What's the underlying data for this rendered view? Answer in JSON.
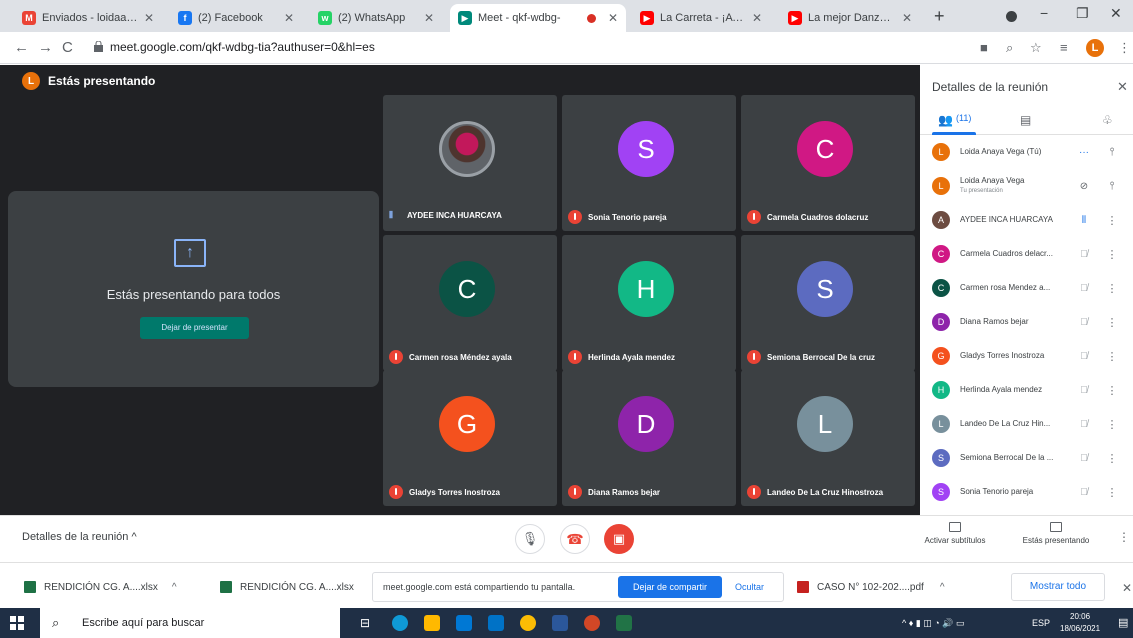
{
  "browser": {
    "tabs": [
      {
        "title": "Enviados - loidaav.2@",
        "favicon": "gmail-icon",
        "favicon_color": "#ea4335",
        "favicon_glyph": "M"
      },
      {
        "title": "(2) Facebook",
        "favicon": "facebook-icon",
        "favicon_color": "#1877f2",
        "favicon_glyph": "f"
      },
      {
        "title": "(2) WhatsApp",
        "favicon": "whatsapp-icon",
        "favicon_color": "#25d366",
        "favicon_glyph": "w"
      },
      {
        "title": "Meet - qkf-wdbg-",
        "favicon": "meet-icon",
        "favicon_color": "#00897b",
        "favicon_glyph": "▶",
        "active": true
      },
      {
        "title": "La Carreta - ¡A quién",
        "favicon": "youtube-icon",
        "favicon_color": "#ff0000",
        "favicon_glyph": "▶"
      },
      {
        "title": "La mejor Danza TINKU",
        "favicon": "youtube-icon",
        "favicon_color": "#ff0000",
        "favicon_glyph": "▶"
      }
    ],
    "new_tab": "+",
    "url": "meet.google.com/qkf-wdbg-tia?authuser=0&hl=es"
  },
  "meet": {
    "presenting_label": "Estás presentando",
    "presenter_initial": "L",
    "present_title": "Estás presentando para todos",
    "stop_presenting": "Dejar de presentar",
    "tiles": [
      {
        "name": "AYDEE INCA HUARCAYA",
        "initial": "",
        "color": "#5f6368",
        "mic": "on",
        "photo": true
      },
      {
        "name": "Sonia Tenorio pareja",
        "initial": "S",
        "color": "#a142f4",
        "mic": "off"
      },
      {
        "name": "Carmela Cuadros dolacruz",
        "initial": "C",
        "color": "#d01884",
        "mic": "off"
      },
      {
        "name": "Carmen rosa Méndez ayala",
        "initial": "C",
        "color": "#0b5345",
        "mic": "off"
      },
      {
        "name": "Herlinda Ayala mendez",
        "initial": "H",
        "color": "#12b886",
        "mic": "off"
      },
      {
        "name": "Semiona Berrocal De la cruz",
        "initial": "S",
        "color": "#5c6bc0",
        "mic": "off"
      },
      {
        "name": "Gladys Torres Inostroza",
        "initial": "G",
        "color": "#f4511e",
        "mic": "off"
      },
      {
        "name": "Diana Ramos bejar",
        "initial": "D",
        "color": "#8e24aa",
        "mic": "off"
      },
      {
        "name": "Landeo De La Cruz Hinostroza",
        "initial": "L",
        "color": "#78909c",
        "mic": "off"
      }
    ],
    "details_link": "Detalles de la reunión  ^",
    "captions_label": "Activar subtítulos",
    "presenting_status": "Estás presentando"
  },
  "panel": {
    "title": "Detalles de la reunión",
    "people_count": "(11)",
    "participants": [
      {
        "name": "Loida Anaya Vega (Tú)",
        "sub": "",
        "initial": "L",
        "color": "#e8710a",
        "mic": "more"
      },
      {
        "name": "Loida Anaya Vega",
        "sub": "Tu presentación",
        "initial": "L",
        "color": "#e8710a",
        "mic": "present"
      },
      {
        "name": "AYDEE INCA HUARCAYA",
        "sub": "",
        "initial": "A",
        "color": "#6d4c41",
        "mic": "on"
      },
      {
        "name": "Carmela Cuadros delacr...",
        "sub": "",
        "initial": "C",
        "color": "#d01884",
        "mic": "off"
      },
      {
        "name": "Carmen rosa Mendez a...",
        "sub": "",
        "initial": "C",
        "color": "#0b5345",
        "mic": "off"
      },
      {
        "name": "Diana Ramos bejar",
        "sub": "",
        "initial": "D",
        "color": "#8e24aa",
        "mic": "off"
      },
      {
        "name": "Gladys Torres Inostroza",
        "sub": "",
        "initial": "G",
        "color": "#f4511e",
        "mic": "off"
      },
      {
        "name": "Herlinda Ayala mendez",
        "sub": "",
        "initial": "H",
        "color": "#12b886",
        "mic": "off"
      },
      {
        "name": "Landeo De La Cruz Hin...",
        "sub": "",
        "initial": "L",
        "color": "#78909c",
        "mic": "off"
      },
      {
        "name": "Semiona Berrocal De la ...",
        "sub": "",
        "initial": "S",
        "color": "#5c6bc0",
        "mic": "off"
      },
      {
        "name": "Sonia Tenorio pareja",
        "sub": "",
        "initial": "S",
        "color": "#a142f4",
        "mic": "off"
      }
    ]
  },
  "downloads": {
    "items": [
      {
        "name": "RENDICIÓN CG. A....xlsx",
        "type": "xlsx"
      },
      {
        "name": "RENDICIÓN CG. A....xlsx",
        "type": "xlsx"
      },
      {
        "name": "CASO N° 102-202....pdf",
        "type": "pdf"
      }
    ],
    "share_text": "meet.google.com está compartiendo tu pantalla.",
    "stop_share": "Dejar de compartir",
    "hide": "Ocultar",
    "show_all": "Mostrar todo"
  },
  "taskbar": {
    "search_placeholder": "Escribe aquí para buscar",
    "lang": "ESP",
    "time": "20:06",
    "date": "18/06/2021"
  }
}
